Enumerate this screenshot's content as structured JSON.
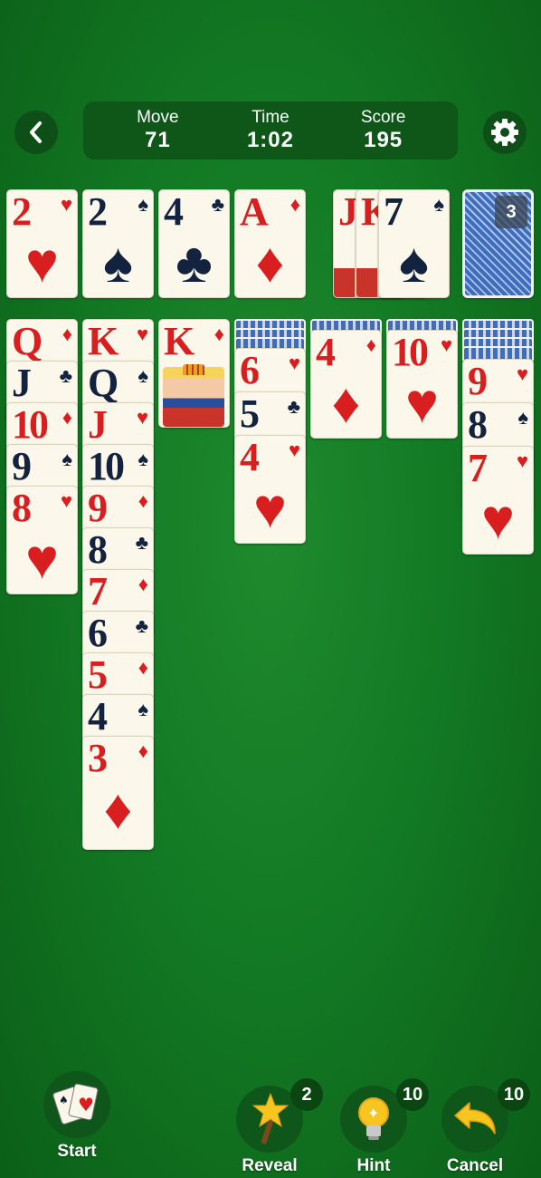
{
  "header": {
    "back_icon": "chevron-left-icon",
    "settings_icon": "gear-icon",
    "stats": [
      {
        "label": "Move",
        "value": "71"
      },
      {
        "label": "Time",
        "value": "1:02"
      },
      {
        "label": "Score",
        "value": "195"
      }
    ]
  },
  "foundations": [
    {
      "rank": "2",
      "suit": "♥",
      "color": "red"
    },
    {
      "rank": "2",
      "suit": "♠",
      "color": "black"
    },
    {
      "rank": "4",
      "suit": "♣",
      "color": "black"
    },
    {
      "rank": "A",
      "suit": "♦",
      "color": "red"
    }
  ],
  "waste": [
    {
      "rank": "J",
      "suit": "",
      "color": "red"
    },
    {
      "rank": "K",
      "suit": "",
      "color": "red"
    },
    {
      "rank": "7",
      "suit": "♠",
      "color": "black"
    }
  ],
  "stock": {
    "count": "3"
  },
  "tableau": {
    "col1": [
      {
        "rank": "Q",
        "suit": "♦",
        "color": "red"
      },
      {
        "rank": "J",
        "suit": "♣",
        "color": "black"
      },
      {
        "rank": "10",
        "suit": "♦",
        "color": "red"
      },
      {
        "rank": "9",
        "suit": "♠",
        "color": "black"
      },
      {
        "rank": "8",
        "suit": "♥",
        "color": "red"
      }
    ],
    "col2": [
      {
        "rank": "K",
        "suit": "♥",
        "color": "red"
      },
      {
        "rank": "Q",
        "suit": "♠",
        "color": "black"
      },
      {
        "rank": "J",
        "suit": "♥",
        "color": "red"
      },
      {
        "rank": "10",
        "suit": "♠",
        "color": "black"
      },
      {
        "rank": "9",
        "suit": "♦",
        "color": "red"
      },
      {
        "rank": "8",
        "suit": "♣",
        "color": "black"
      },
      {
        "rank": "7",
        "suit": "♦",
        "color": "red"
      },
      {
        "rank": "6",
        "suit": "♣",
        "color": "black"
      },
      {
        "rank": "5",
        "suit": "♦",
        "color": "red"
      },
      {
        "rank": "4",
        "suit": "♠",
        "color": "black"
      },
      {
        "rank": "3",
        "suit": "♦",
        "color": "red"
      }
    ],
    "col3": [
      {
        "rank": "K",
        "suit": "♦",
        "color": "red"
      }
    ],
    "col4": [
      {
        "rank": "6",
        "suit": "♥",
        "color": "red"
      },
      {
        "rank": "5",
        "suit": "♣",
        "color": "black"
      },
      {
        "rank": "4",
        "suit": "♥",
        "color": "red"
      }
    ],
    "col5": [
      {
        "rank": "4",
        "suit": "♦",
        "color": "red"
      }
    ],
    "col6": [
      {
        "rank": "10",
        "suit": "♥",
        "color": "red"
      }
    ],
    "col7": [
      {
        "rank": "9",
        "suit": "♥",
        "color": "red"
      },
      {
        "rank": "8",
        "suit": "♠",
        "color": "black"
      },
      {
        "rank": "7",
        "suit": "♥",
        "color": "red"
      }
    ]
  },
  "toolbar": {
    "start": {
      "label": "Start",
      "icon": "cards-icon"
    },
    "reveal": {
      "label": "Reveal",
      "icon": "magic-wand-icon",
      "badge": "2"
    },
    "hint": {
      "label": "Hint",
      "icon": "lightbulb-icon",
      "badge": "10"
    },
    "cancel": {
      "label": "Cancel",
      "icon": "undo-arrow-icon",
      "badge": "10"
    }
  },
  "colors": {
    "red_suit": "#d81e1e",
    "black_suit": "#13233f",
    "felt": "#137a24"
  }
}
